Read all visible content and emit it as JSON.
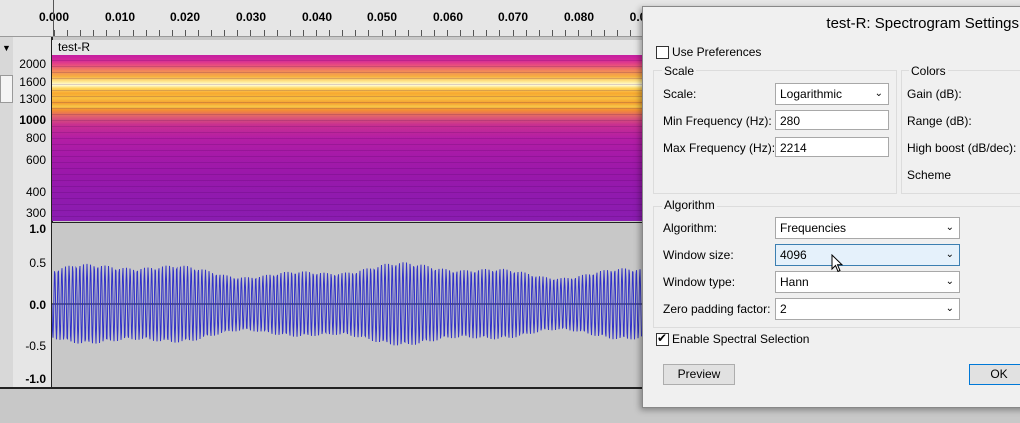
{
  "ruler": {
    "ticks": [
      "0.000",
      "0.010",
      "0.020",
      "0.030",
      "0.040",
      "0.050",
      "0.060",
      "0.070",
      "0.080",
      "0.0"
    ]
  },
  "track": {
    "name": "test-R",
    "freq_labels": [
      "2000",
      "1600",
      "1300",
      "1000",
      "800",
      "600",
      "400",
      "300"
    ],
    "amp_labels": [
      "1.0",
      "0.5",
      "0.0",
      "-0.5",
      "-1.0"
    ]
  },
  "dialog": {
    "title": "test-R: Spectrogram Settings",
    "use_preferences": {
      "label": "Use Preferences",
      "checked": false
    },
    "scale_group": {
      "title": "Scale",
      "scale_label": "Scale:",
      "scale_value": "Logarithmic",
      "min_freq_label": "Min Frequency (Hz):",
      "min_freq_value": "280",
      "max_freq_label": "Max Frequency (Hz):",
      "max_freq_value": "2214"
    },
    "colors_group": {
      "title": "Colors",
      "gain_label": "Gain (dB):",
      "range_label": "Range (dB):",
      "high_boost_label": "High boost (dB/dec):",
      "scheme_label": "Scheme"
    },
    "algorithm_group": {
      "title": "Algorithm",
      "algorithm_label": "Algorithm:",
      "algorithm_value": "Frequencies",
      "window_size_label": "Window size:",
      "window_size_value": "4096",
      "window_type_label": "Window type:",
      "window_type_value": "Hann",
      "zero_padding_label": "Zero padding factor:",
      "zero_padding_value": "2"
    },
    "enable_spectral": {
      "label": "Enable Spectral Selection",
      "checked": true
    },
    "preview_label": "Preview",
    "ok_label": "OK"
  },
  "colors": {
    "waveform": "#3232c8",
    "selection_accent": "#0078d7"
  }
}
